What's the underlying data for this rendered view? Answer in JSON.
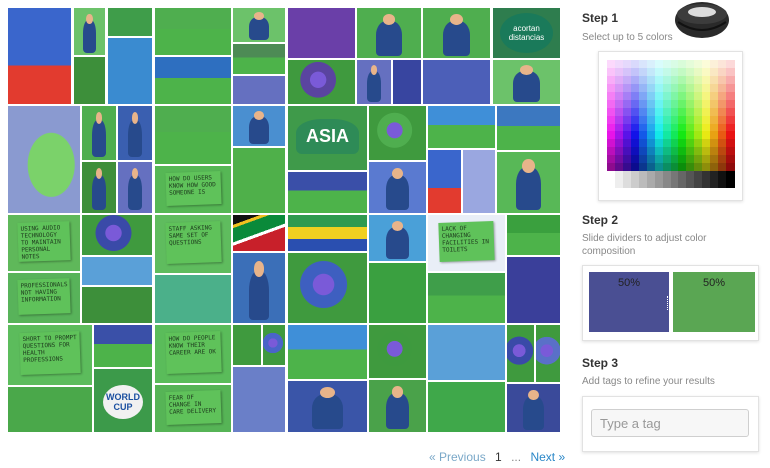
{
  "steps": [
    {
      "title": "Step 1",
      "desc": "Select up to 5 colors"
    },
    {
      "title": "Step 2",
      "desc": "Slide dividers to adjust color composition"
    },
    {
      "title": "Step 3",
      "desc": "Add tags to refine your results"
    }
  ],
  "composition": [
    {
      "label": "50%",
      "color": "#4a4f93",
      "share": 0.5
    },
    {
      "label": "50%",
      "color": "#5aa653",
      "share": 0.5
    }
  ],
  "tag_input": {
    "placeholder": "Type a tag"
  },
  "pagination": {
    "prev": "« Previous",
    "current": "1",
    "ellipsis": "...",
    "next": "Next »"
  },
  "mosaic_text": {
    "note_audio": "Using audio technology to maintain personal notes",
    "note_users": "How do users know how good someone is",
    "note_staff": "Staff asking same set of questions",
    "note_lack": "Lack of changing facilities in toilets",
    "note_professionals": "Professionals not having information",
    "note_prompt": "Short to prompt questions for health professions",
    "note_career": "How do people know their career are OK",
    "note_fear": "Fear of change in care delivery",
    "badge": "acortan distancias",
    "asia": "ASIA",
    "worldcup": "WORLD CUP"
  },
  "colors": {
    "accent_link": "#2a87c8",
    "photo_green": "#4fae4f",
    "photo_blue": "#4a57a8"
  }
}
